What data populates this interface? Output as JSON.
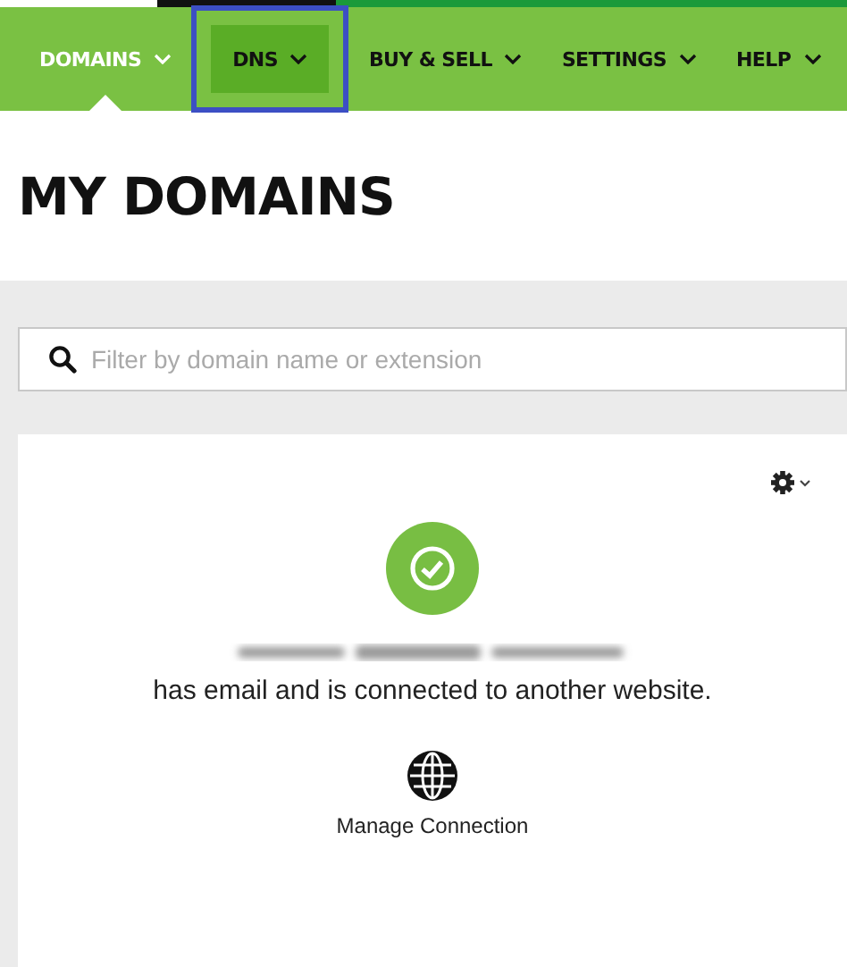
{
  "nav": [
    {
      "label": "DOMAINS",
      "selected": true,
      "highlighted": false
    },
    {
      "label": "DNS",
      "selected": false,
      "highlighted": true
    },
    {
      "label": "BUY & SELL",
      "selected": false,
      "highlighted": false
    },
    {
      "label": "SETTINGS",
      "selected": false,
      "highlighted": false
    },
    {
      "label": "HELP",
      "selected": false,
      "highlighted": false
    }
  ],
  "page_title": "MY DOMAINS",
  "search": {
    "placeholder": "Filter by domain name or extension"
  },
  "domain_card": {
    "status_text": "has email and is connected to another website.",
    "action": "Manage Connection"
  }
}
